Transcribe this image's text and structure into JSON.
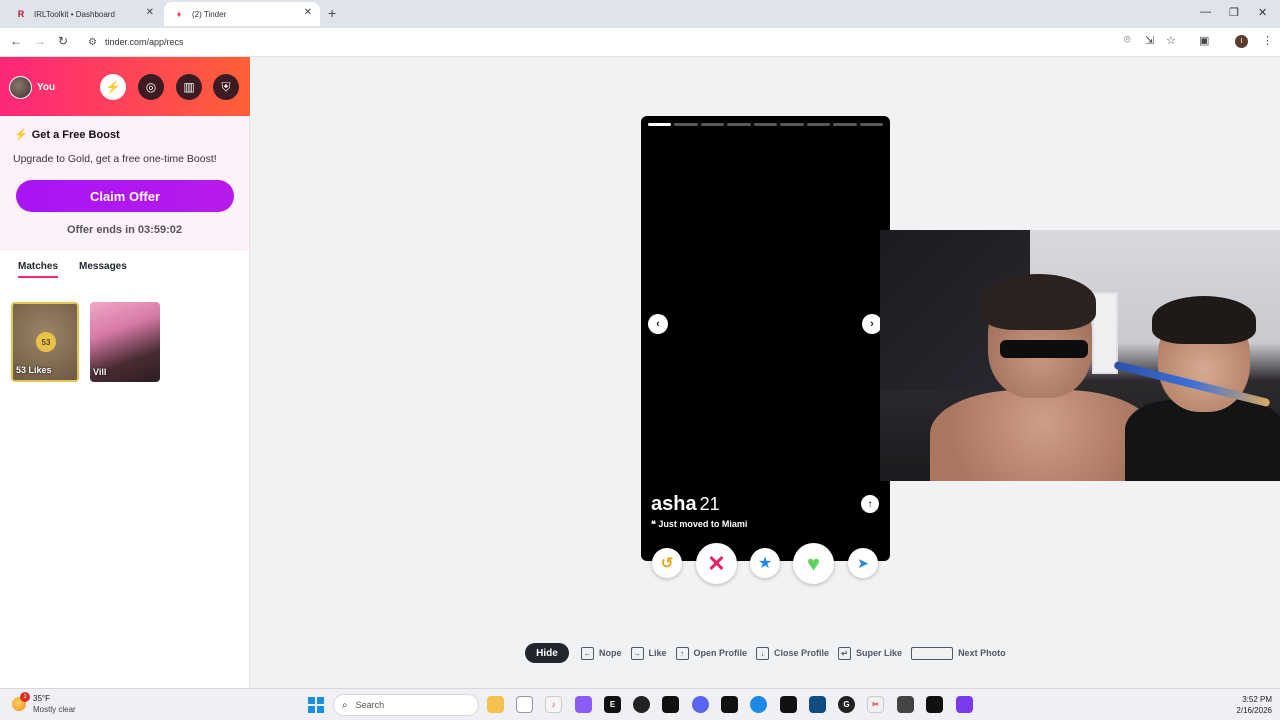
{
  "browser": {
    "tabs": [
      {
        "title": "IRLToolkit • Dashboard",
        "active": false
      },
      {
        "title": "(2) Tinder",
        "active": true
      }
    ],
    "url": "tinder.com/app/recs"
  },
  "sidebar": {
    "user_label": "You",
    "promo": {
      "title": "Get a Free Boost",
      "subtitle": "Upgrade to Gold, get a free one-time Boost!",
      "button": "Claim Offer",
      "offer_ends": "Offer ends in 03:59:02"
    },
    "tabs": [
      "Matches",
      "Messages"
    ],
    "likes": {
      "count": "53",
      "label": "53 Likes"
    },
    "match": {
      "name": "Vill"
    }
  },
  "card": {
    "name": "asha",
    "age": "21",
    "bio": "Just moved to Miami",
    "photo_count": 9,
    "active_photo": 1
  },
  "hints": {
    "hide_label": "Hide",
    "items": [
      "Nope",
      "Like",
      "Open Profile",
      "Close Profile",
      "Super Like",
      "Next Photo"
    ]
  },
  "taskbar": {
    "temperature": "35°F",
    "weather": "Mostly clear",
    "weather_badge": "1",
    "search_placeholder": "Search",
    "time": "3:52 PM",
    "date": "2/16/2026"
  },
  "colors": {
    "brand_gradient_start": "#fd267a",
    "brand_gradient_end": "#ff6036",
    "gold_purple": "#a914f5",
    "nope": "#e91e63",
    "like": "#5ed35a",
    "super": "#1e88e5",
    "rewind": "#e8a317"
  }
}
